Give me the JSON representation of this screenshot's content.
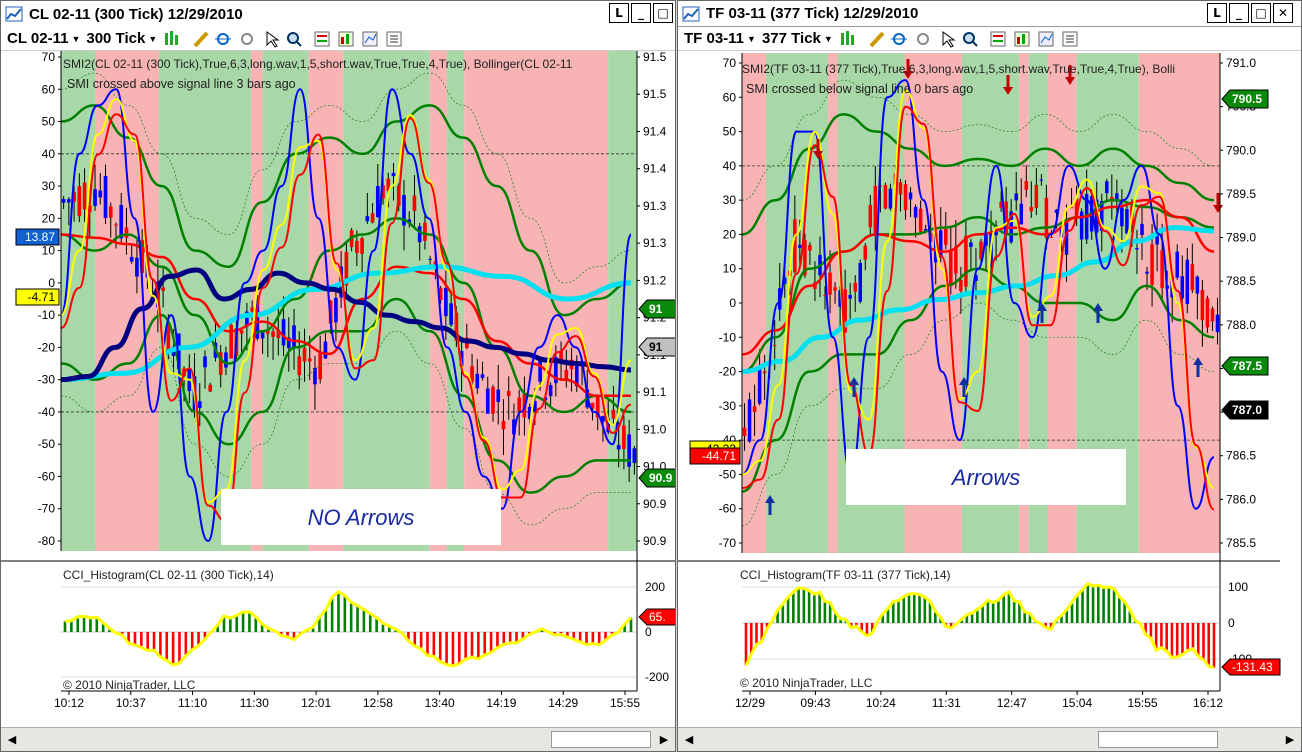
{
  "left": {
    "title": "CL 02-11  (300 Tick)  12/29/2010",
    "instrument": "CL 02-11",
    "period": "300 Tick",
    "indicator_line": "SMI2(CL  02-11  (300  Tick),True,6,3,long.wav,1,5,short.wav,True,True,4,True),  Bollinger(CL  02-11",
    "status_line": "SMI crossed above signal line  3 bars ago",
    "note": "NO Arrows",
    "cci_label": "CCI_Histogram(CL 02-11 (300 Tick),14)",
    "copyright": "© 2010 NinjaTrader, LLC",
    "left_axis": [
      "70",
      "60",
      "50",
      "40",
      "30",
      "20",
      "10",
      "0",
      "-10",
      "-20",
      "-30",
      "-40",
      "-50",
      "-60",
      "-70",
      "-80"
    ],
    "right_axis": [
      "91.5",
      "91.5",
      "91.4",
      "91.4",
      "91.3",
      "91.3",
      "91.2",
      "91.2",
      "91.1",
      "91.1",
      "91.0",
      "91.0",
      "90.9",
      "90.9"
    ],
    "right_tags": [
      "91",
      "91",
      "90.9"
    ],
    "left_tags": [
      "13.87",
      "-4.71"
    ],
    "cci_axis": [
      "200",
      "0",
      "-200"
    ],
    "cci_tag": "65.",
    "time_axis": [
      "10:12",
      "10:37",
      "11:10",
      "11:30",
      "12:01",
      "12:58",
      "13:40",
      "14:19",
      "14:29",
      "15:55"
    ]
  },
  "right": {
    "title": "TF 03-11  (377 Tick)  12/29/2010",
    "instrument": "TF 03-11",
    "period": "377 Tick",
    "indicator_line": "SMI2(TF  03-11  (377  Tick),True,6,3,long.wav,1,5,short.wav,True,True,4,True),  Bolli",
    "status_line": "SMI crossed below signal line  0 bars ago",
    "note": "Arrows",
    "cci_label": "CCI_Histogram(TF 03-11 (377 Tick),14)",
    "copyright": "© 2010 NinjaTrader, LLC",
    "left_axis": [
      "70",
      "60",
      "50",
      "40",
      "30",
      "20",
      "10",
      "0",
      "-10",
      "-20",
      "-30",
      "-40",
      "-50",
      "-60",
      "-70"
    ],
    "right_axis": [
      "791.0",
      "790.5",
      "790.0",
      "789.5",
      "789.0",
      "788.5",
      "788.0",
      "787.5",
      "787.0",
      "786.5",
      "786.0",
      "785.5"
    ],
    "right_tags": [
      "790.5",
      "787.5",
      "787.0"
    ],
    "left_tags": [
      "-42.23",
      "-44.71"
    ],
    "cci_axis": [
      "100",
      "0",
      "-100"
    ],
    "cci_tag": "-131.43",
    "time_axis": [
      "12/29",
      "09:43",
      "10:24",
      "11:31",
      "12:47",
      "15:04",
      "15:55",
      "16:12"
    ]
  },
  "colors": {
    "green_zone": "#a8d8a8",
    "red_zone": "#f8b4b4",
    "smi": "#0000ff",
    "signal": "#ffff00",
    "bollinger": "#008000",
    "ma": "#00e0f0",
    "ma_dark": "#000080",
    "cci_up": "#008000",
    "cci_down": "#ff0000",
    "cci_line": "#ffff00"
  },
  "chart_data": [
    {
      "type": "line",
      "title": "CL 02-11 (300 Tick) 12/29/2010",
      "series": [
        {
          "name": "SMI",
          "values": [
            -10,
            40,
            55,
            60,
            20,
            -40,
            -10,
            -60,
            -80,
            -40,
            0,
            10,
            30,
            60,
            20,
            -20,
            -30,
            10,
            60,
            40,
            20,
            -20,
            -40,
            -60,
            -70,
            -40,
            -20,
            -10,
            -20,
            -40,
            -50,
            15
          ]
        },
        {
          "name": "CCI_Histogram",
          "values": [
            50,
            80,
            20,
            -60,
            -90,
            -150,
            -40,
            60,
            100,
            20,
            -30,
            20,
            180,
            120,
            40,
            -20,
            -100,
            -150,
            -120,
            -80,
            -40,
            10,
            -20,
            -60,
            -40,
            65
          ]
        }
      ],
      "ylim": [
        -80,
        70
      ]
    },
    {
      "type": "line",
      "title": "TF 03-11 (377 Tick) 12/29/2010",
      "series": [
        {
          "name": "SMI",
          "values": [
            -50,
            -40,
            0,
            50,
            50,
            -10,
            -50,
            -10,
            60,
            65,
            30,
            -20,
            -40,
            10,
            40,
            0,
            -10,
            20,
            40,
            30,
            10,
            30,
            40,
            20,
            -30,
            -60,
            -45
          ]
        },
        {
          "name": "CCI_Histogram",
          "values": [
            -120,
            -20,
            80,
            100,
            60,
            0,
            -40,
            40,
            90,
            60,
            -20,
            20,
            60,
            80,
            20,
            -20,
            60,
            110,
            100,
            20,
            -60,
            -100,
            -80,
            -131.43
          ]
        }
      ],
      "ylim": [
        -70,
        70
      ]
    }
  ]
}
